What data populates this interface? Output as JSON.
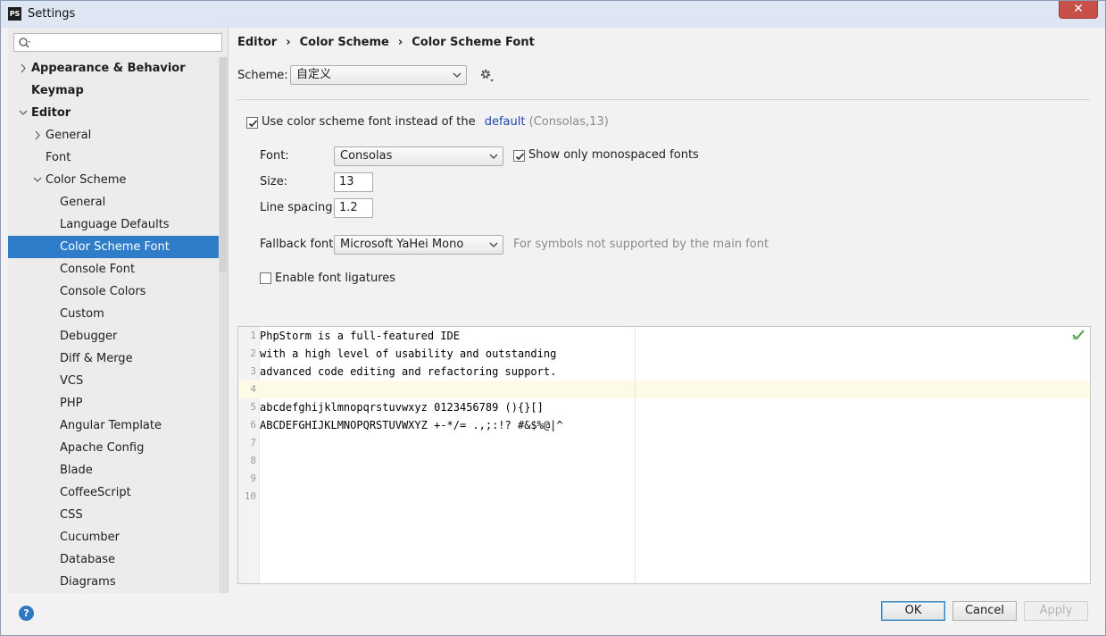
{
  "window": {
    "title": "Settings",
    "logo": "PS",
    "close_glyph": "✕"
  },
  "search": {
    "placeholder": "",
    "value": ""
  },
  "sidebar": {
    "items": [
      {
        "label": "Appearance & Behavior",
        "bold": true,
        "chevron": "right",
        "level": 0
      },
      {
        "label": "Keymap",
        "bold": true,
        "chevron": "none",
        "level": 0
      },
      {
        "label": "Editor",
        "bold": true,
        "chevron": "down",
        "level": 0
      },
      {
        "label": "General",
        "bold": false,
        "chevron": "right",
        "level": 1
      },
      {
        "label": "Font",
        "bold": false,
        "chevron": "none",
        "level": 1
      },
      {
        "label": "Color Scheme",
        "bold": false,
        "chevron": "down",
        "level": 1
      },
      {
        "label": "General",
        "bold": false,
        "chevron": "none",
        "level": 2
      },
      {
        "label": "Language Defaults",
        "bold": false,
        "chevron": "none",
        "level": 2
      },
      {
        "label": "Color Scheme Font",
        "bold": false,
        "chevron": "none",
        "level": 2,
        "selected": true
      },
      {
        "label": "Console Font",
        "bold": false,
        "chevron": "none",
        "level": 2
      },
      {
        "label": "Console Colors",
        "bold": false,
        "chevron": "none",
        "level": 2
      },
      {
        "label": "Custom",
        "bold": false,
        "chevron": "none",
        "level": 2
      },
      {
        "label": "Debugger",
        "bold": false,
        "chevron": "none",
        "level": 2
      },
      {
        "label": "Diff & Merge",
        "bold": false,
        "chevron": "none",
        "level": 2
      },
      {
        "label": "VCS",
        "bold": false,
        "chevron": "none",
        "level": 2
      },
      {
        "label": "PHP",
        "bold": false,
        "chevron": "none",
        "level": 2
      },
      {
        "label": "Angular Template",
        "bold": false,
        "chevron": "none",
        "level": 2
      },
      {
        "label": "Apache Config",
        "bold": false,
        "chevron": "none",
        "level": 2
      },
      {
        "label": "Blade",
        "bold": false,
        "chevron": "none",
        "level": 2
      },
      {
        "label": "CoffeeScript",
        "bold": false,
        "chevron": "none",
        "level": 2
      },
      {
        "label": "CSS",
        "bold": false,
        "chevron": "none",
        "level": 2
      },
      {
        "label": "Cucumber",
        "bold": false,
        "chevron": "none",
        "level": 2
      },
      {
        "label": "Database",
        "bold": false,
        "chevron": "none",
        "level": 2
      },
      {
        "label": "Diagrams",
        "bold": false,
        "chevron": "none",
        "level": 2
      }
    ]
  },
  "breadcrumb": {
    "part1": "Editor",
    "part2": "Color Scheme",
    "part3": "Color Scheme Font",
    "sep": "›"
  },
  "scheme": {
    "label": "Scheme:",
    "value": "自定义"
  },
  "use_scheme_font": {
    "checked": true,
    "label": "Use color scheme font instead of the",
    "link": "default",
    "hint": "(Consolas,13)"
  },
  "font": {
    "label": "Font:",
    "value": "Consolas",
    "mono_checked": true,
    "mono_label": "Show only monospaced fonts"
  },
  "size": {
    "label": "Size:",
    "value": "13"
  },
  "line_spacing": {
    "label": "Line spacing:",
    "value": "1.2"
  },
  "fallback": {
    "label": "Fallback font:",
    "value": "Microsoft YaHei Mono",
    "hint": "For symbols not supported by the main font"
  },
  "ligatures": {
    "checked": false,
    "label": "Enable font ligatures"
  },
  "preview": {
    "lines": [
      {
        "n": "1",
        "code": "PhpStorm is a full-featured IDE"
      },
      {
        "n": "2",
        "code": "with a high level of usability and outstanding"
      },
      {
        "n": "3",
        "code": "advanced code editing and refactoring support."
      },
      {
        "n": "4",
        "code": "",
        "current": true
      },
      {
        "n": "5",
        "code": "abcdefghijklmnopqrstuvwxyz 0123456789 (){}[]"
      },
      {
        "n": "6",
        "code": "ABCDEFGHIJKLMNOPQRSTUVWXYZ +-*/= .,;:!? #&$%@|^"
      },
      {
        "n": "7",
        "code": ""
      },
      {
        "n": "8",
        "code": ""
      },
      {
        "n": "9",
        "code": ""
      },
      {
        "n": "10",
        "code": ""
      }
    ]
  },
  "buttons": {
    "help": "?",
    "ok": "OK",
    "cancel": "Cancel",
    "apply": "Apply"
  },
  "colors": {
    "selection": "#2f7dc8",
    "link": "#1f47a8",
    "current_line": "#fdfae6",
    "ok_mark": "#4aa24a"
  }
}
